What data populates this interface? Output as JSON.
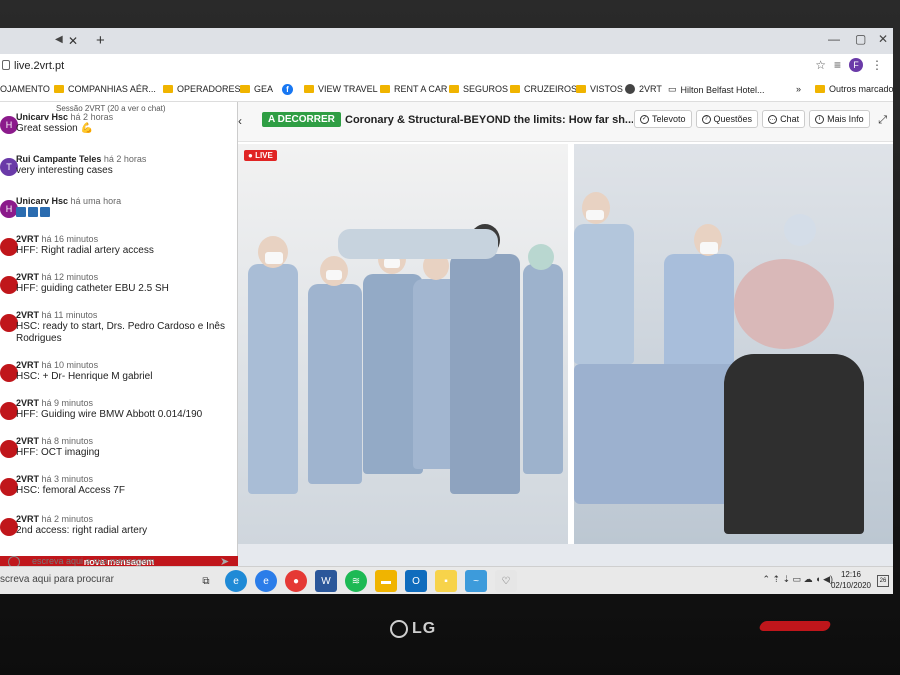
{
  "browser": {
    "url": "live.2vrt.pt",
    "profile_initial": "F",
    "bookmarks": [
      {
        "label": "OJAMENTO",
        "icon": "none"
      },
      {
        "label": "COMPANHIAS AÉR...",
        "icon": "folder-icon"
      },
      {
        "label": "OPERADORES",
        "icon": "folder-icon"
      },
      {
        "label": "GEA",
        "icon": "folder-icon"
      },
      {
        "label": "",
        "icon": "facebook-icon"
      },
      {
        "label": "VIEW TRAVEL",
        "icon": "folder-icon"
      },
      {
        "label": "RENT A CAR",
        "icon": "folder-icon"
      },
      {
        "label": "SEGUROS",
        "icon": "folder-icon"
      },
      {
        "label": "CRUZEIROS",
        "icon": "folder-icon"
      },
      {
        "label": "VISTOS",
        "icon": "folder-icon"
      },
      {
        "label": "2VRT",
        "icon": "globe-icon"
      },
      {
        "label": "Hilton Belfast Hotel...",
        "icon": "page-icon"
      },
      {
        "label": "Outros marcadores",
        "icon": "folder-icon"
      }
    ]
  },
  "chat": {
    "header": "Sessão 2VRT (20 a ver o chat)",
    "messages": [
      {
        "author": "Unicarv Hsc",
        "time": "há 2 horas",
        "text": "Great session 💪",
        "avatar": "H",
        "avatar_color": "#8b1a8b"
      },
      {
        "author": "Rui Campante Teles",
        "time": "há 2 horas",
        "text": "very interesting cases",
        "avatar": "T",
        "avatar_color": "#6a3aa8"
      },
      {
        "author": "Unicarv Hsc",
        "time": "há uma hora",
        "text": "",
        "avatar": "H",
        "avatar_color": "#8b1a8b"
      },
      {
        "author": "2VRT",
        "time": "há 16 minutos",
        "text": "HFF: Right radial artery access",
        "avatar": "",
        "avatar_color": "#c0161b"
      },
      {
        "author": "2VRT",
        "time": "há 12 minutos",
        "text": "HFF: guiding catheter EBU 2.5 SH",
        "avatar": "",
        "avatar_color": "#c0161b"
      },
      {
        "author": "2VRT",
        "time": "há 11 minutos",
        "text": "HSC: ready to start, Drs. Pedro Cardoso e Inês Rodrigues",
        "avatar": "",
        "avatar_color": "#c0161b"
      },
      {
        "author": "2VRT",
        "time": "há 10 minutos",
        "text": "HSC: + Dr- Henrique M gabriel",
        "avatar": "",
        "avatar_color": "#c0161b"
      },
      {
        "author": "2VRT",
        "time": "há 9 minutos",
        "text": "HFF: Guiding wire BMW Abbott 0.014/190",
        "avatar": "",
        "avatar_color": "#c0161b"
      },
      {
        "author": "2VRT",
        "time": "há 8 minutos",
        "text": "HFF: OCT imaging",
        "avatar": "",
        "avatar_color": "#c0161b"
      },
      {
        "author": "2VRT",
        "time": "há 3 minutos",
        "text": "HSC: femoral Access 7F",
        "avatar": "",
        "avatar_color": "#c0161b"
      },
      {
        "author": "2VRT",
        "time": "há 2 minutos",
        "text": "2nd access: right radial artery",
        "avatar": "",
        "avatar_color": "#c0161b"
      }
    ],
    "new_message_banner": "nova mensagem",
    "input_placeholder": "escreva aqui a sua mensagem"
  },
  "session": {
    "status_badge": "A DECORRER",
    "title": "Coronary & Structural-BEYOND the limits: How far sh...",
    "buttons": [
      "Televoto",
      "Questões",
      "Chat",
      "Mais Info"
    ],
    "live_label": "LIVE"
  },
  "taskbar": {
    "search_placeholder": "screva aqui para procurar",
    "time": "12:16",
    "date": "02/10/2020",
    "notification_count": "26"
  },
  "bezel": {
    "brand": "LG"
  }
}
